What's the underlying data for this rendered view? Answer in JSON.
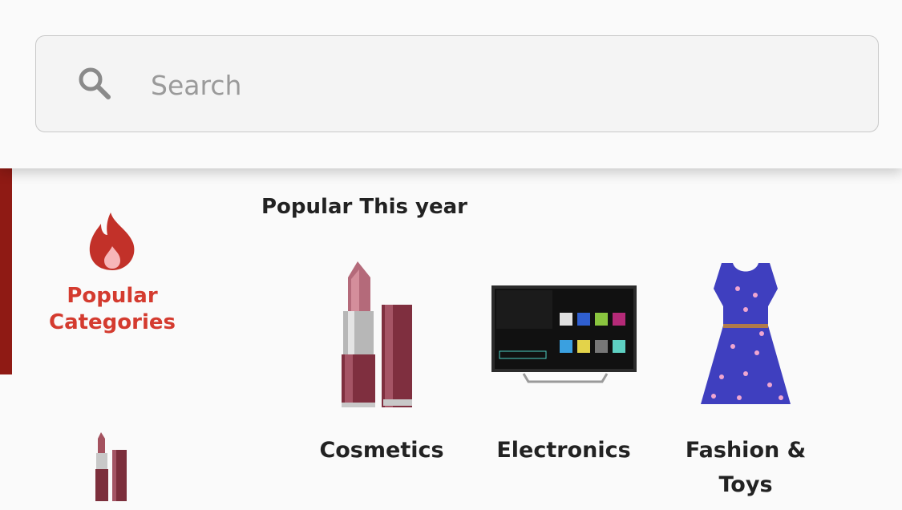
{
  "search": {
    "placeholder": "Search",
    "icon": "search-icon"
  },
  "sidebar": {
    "items": [
      {
        "label": "Popular Categories",
        "icon": "fire-icon",
        "active": true,
        "color": "#d43b2f"
      },
      {
        "label": "",
        "icon": "lipstick-icon",
        "active": false
      }
    ],
    "indicator_color": "#8f1a14"
  },
  "main": {
    "section_title": "Popular This year",
    "categories": [
      {
        "label": "Cosmetics",
        "icon": "lipstick-icon"
      },
      {
        "label": "Electronics",
        "icon": "smart-tv-icon"
      },
      {
        "label": "Fashion &\nToys",
        "icon": "dress-icon"
      }
    ]
  }
}
